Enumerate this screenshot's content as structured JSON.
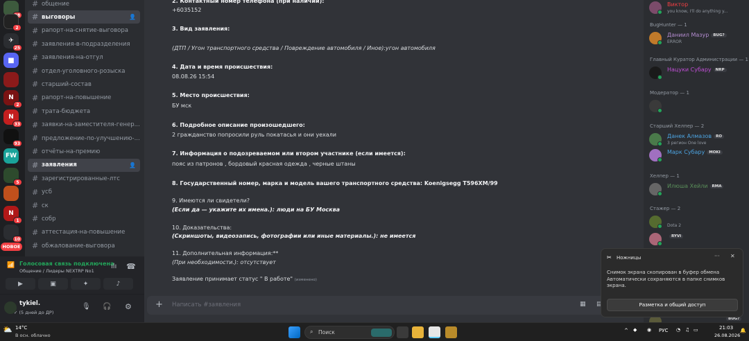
{
  "servers": {
    "badges": [
      "98",
      "2",
      "25",
      "2",
      "33",
      "93",
      "5",
      "1",
      "10"
    ],
    "fw_label": "FW",
    "new_label": "НОВОЕ"
  },
  "channels": [
    {
      "name": "общение",
      "active": false,
      "bold": false,
      "add": false
    },
    {
      "name": "выговоры",
      "active": true,
      "bold": true,
      "add": true
    },
    {
      "name": "рапорт-на-снятие-выговора",
      "active": false,
      "bold": false,
      "add": false
    },
    {
      "name": "заявления-в-подразделения",
      "active": false,
      "bold": false,
      "add": false
    },
    {
      "name": "заявления-на-отгул",
      "active": false,
      "bold": false,
      "add": false
    },
    {
      "name": "отдел-уголовного-розыска",
      "active": false,
      "bold": false,
      "add": false
    },
    {
      "name": "старший-состав",
      "active": false,
      "bold": false,
      "add": false
    },
    {
      "name": "рапорт-на-повышение",
      "active": false,
      "bold": false,
      "add": false
    },
    {
      "name": "трата-бюджета",
      "active": false,
      "bold": false,
      "add": false
    },
    {
      "name": "заявки-на-заместителя-генер...",
      "active": false,
      "bold": false,
      "add": false
    },
    {
      "name": "предложение-по-улучшению-...",
      "active": false,
      "bold": false,
      "add": false
    },
    {
      "name": "отчёты-на-премию",
      "active": false,
      "bold": false,
      "add": false
    },
    {
      "name": "заявления",
      "active": true,
      "bold": true,
      "add": true
    },
    {
      "name": "зарегистрированные-лтс",
      "active": false,
      "bold": false,
      "add": false
    },
    {
      "name": "усб",
      "active": false,
      "bold": false,
      "add": false
    },
    {
      "name": "ск",
      "active": false,
      "bold": false,
      "add": false
    },
    {
      "name": "собр",
      "active": false,
      "bold": false,
      "add": false
    },
    {
      "name": "аттестация-на-повышение",
      "active": false,
      "bold": false,
      "add": false
    },
    {
      "name": "обжалование-выговора",
      "active": false,
      "bold": false,
      "add": false
    }
  ],
  "voice": {
    "status": "Голосовая связь подключена",
    "channel": "Общение / Лидеры NEXTRP No1"
  },
  "user": {
    "name": "tykiel.",
    "status": "✓ (5 дней до ДР)"
  },
  "message_lines": [
    {
      "text": "2. Контактный номер телефона (при наличии):",
      "style": "b"
    },
    {
      "text": " +6035152",
      "style": ""
    },
    {
      "text": "3. Вид заявления:",
      "style": "b"
    },
    {
      "text": "(ДТП / Угон транспортного средства / Повреждение автомобиля / Иное):угон автомобиля",
      "style": "i"
    },
    {
      "text": "4. Дата и время происшествия:",
      "style": "b"
    },
    {
      "text": " 08.08.26  15:54",
      "style": ""
    },
    {
      "text": "5. Место происшествия:",
      "style": "b"
    },
    {
      "text": " БУ мск",
      "style": ""
    },
    {
      "text": "6. Подробное описание произошедшего:",
      "style": "b"
    },
    {
      "text": " 2 гражданство попросили руль покатасья и они уехали",
      "style": ""
    },
    {
      "text": "7. Информация о подозреваемом или втором участнике (если имеется):",
      "style": "b"
    },
    {
      "text": " пояс из патронов , бордовый красная одежда , черные штаны",
      "style": ""
    },
    {
      "text": "8. Государственный номер, марка и модель вашего транспортного средства: Koenigsegg T596XM/99",
      "style": "b"
    },
    {
      "text": "9. Имеются ли свидетели?",
      "style": ""
    },
    {
      "text": "(Если да — укажите их имена.): люди на БУ Москва",
      "style": "b i"
    },
    {
      "text": "10. Доказательства:",
      "style": ""
    },
    {
      "text": "(Скриншоты, видеозапись, фотографии или иные материалы.): не имеется",
      "style": "b i"
    },
    {
      "text": "11. Дополнительная информация:**",
      "style": ""
    },
    {
      "text": "(При необходимости.): отсутствует",
      "style": "i"
    }
  ],
  "last_line": {
    "text": "Заявление принимает статус \" В работе\"",
    "edited": "(изменено)"
  },
  "composer": {
    "placeholder": "Написать #заявления"
  },
  "members": {
    "top_member": {
      "name": "Виктор",
      "status": "you know, I'll do anything y..."
    },
    "groups": [
      {
        "header": "BugHunter — 1",
        "members": [
          {
            "name": "Даниил Мазур",
            "tag": "BUG?",
            "status": "ERROR",
            "color": "#b48cd0"
          }
        ]
      },
      {
        "header": "Главный Куратор Администрации — 1",
        "members": [
          {
            "name": "Нацуки Субару",
            "tag": "NRP",
            "status": "",
            "color": "#c04fd6"
          }
        ]
      },
      {
        "header": "Модератор — 1",
        "members": [
          {
            "name": "",
            "tag": "",
            "status": "",
            "color": "#8a3c3c"
          }
        ]
      },
      {
        "header": "Старший Хелпер — 2",
        "members": [
          {
            "name": "Данек Алмазов",
            "tag": "RO",
            "status": "3 регион One love",
            "color": "#4ca3e0"
          },
          {
            "name": "Марк Субару",
            "tag": "MOKI",
            "status": "",
            "color": "#4ca3e0"
          }
        ]
      },
      {
        "header": "Хелпер — 1",
        "members": [
          {
            "name": "Илюша Хейли",
            "tag": "RMA",
            "status": "",
            "color": "#5a8f5a"
          }
        ]
      },
      {
        "header": "Стажер — 2",
        "members": [
          {
            "name": "",
            "tag": "",
            "status": "Dota 2",
            "color": "#6a7d4a"
          },
          {
            "name": "",
            "tag": "RYVI",
            "status": "",
            "color": "#6a7d4a"
          }
        ]
      }
    ],
    "bottom_tag": "BUG?"
  },
  "toast": {
    "app": "Ножницы",
    "title": "Снимок экрана скопирован в буфер обмена",
    "body": "Автоматически сохраняются в папке снимков экрана.",
    "button": "Разметка и общий доступ"
  },
  "taskbar": {
    "temp": "14°C",
    "weather": "В осн. облачно",
    "search": "Поиск",
    "lang": "РУС",
    "time": "21:03",
    "date": "26.08.2026"
  },
  "colors": {
    "accent": "#5865f2",
    "online": "#23a55a",
    "danger": "#f23f43"
  }
}
